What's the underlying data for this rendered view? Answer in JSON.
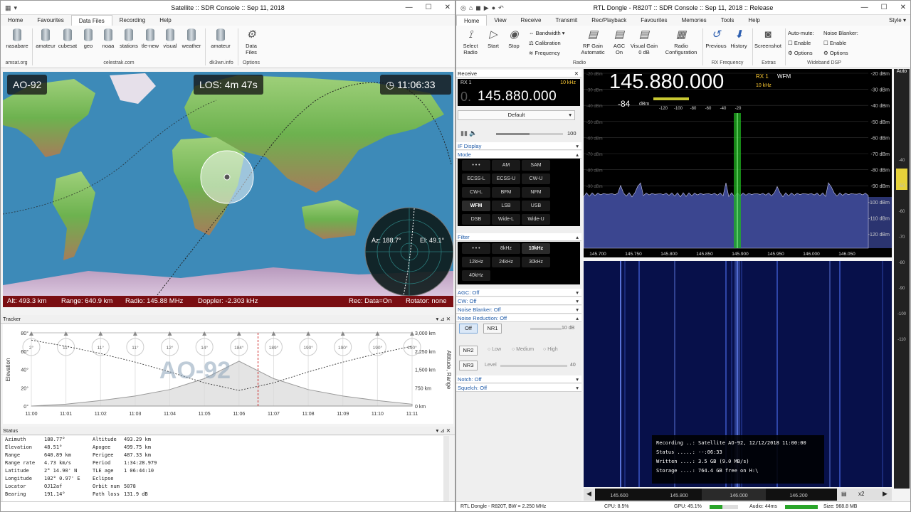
{
  "left": {
    "title": "Satellite :: SDR Console :: Sep 11, 2018",
    "tabs": [
      "Home",
      "Favourites",
      "Data Files",
      "Recording",
      "Help"
    ],
    "active_tab": "Data Files",
    "ribbon_buttons": [
      "nasabare",
      "amateur",
      "cubesat",
      "geo",
      "noaa",
      "stations",
      "tle-new",
      "visual",
      "weather",
      "amateur",
      "Data Files"
    ],
    "group_captions": [
      "amsat.org",
      "celestrak.com",
      "dk3wn.info",
      "Options"
    ],
    "sat_name": "AO-92",
    "los": "LOS: 4m 47s",
    "clock": "11:06:33",
    "az": "Az: 188.7°",
    "el": "El: 49.1°",
    "alt": "Alt: 493.3 km",
    "range": "Range: 640.9 km",
    "radio": "Radio: 145.88 MHz",
    "doppler": "Doppler: -2.303 kHz",
    "rec": "Rec: Data=On",
    "rotator": "Rotator: none",
    "tracker_title": "Tracker",
    "tracker_watermark": "AO-92",
    "tracker_ylabel": "Elevation",
    "tracker_y2label": "Altitude, Range",
    "status_title": "Status",
    "status_left": [
      [
        "Azimuth",
        "188.77°"
      ],
      [
        "Elevation",
        "48.51°"
      ],
      [
        "Range",
        "640.89 km"
      ],
      [
        "Range rate",
        "4.73 km/s"
      ],
      [
        "Latitude",
        "2° 14.90' N"
      ],
      [
        "Longitude",
        "102° 0.97' E"
      ],
      [
        "Locator",
        "OJ12af"
      ],
      [
        "Bearing",
        "191.14°"
      ]
    ],
    "status_right": [
      [
        "Altitude",
        "493.29 km"
      ],
      [
        "Apogee",
        "499.75 km"
      ],
      [
        "Perigee",
        "487.33 km"
      ],
      [
        "Period",
        "1:34:28.979"
      ],
      [
        "TLE age",
        "1 06:44:10"
      ],
      [
        "Eclipse",
        ""
      ],
      [
        "Orbit num",
        "5078"
      ],
      [
        "Path loss",
        "131.9 dB"
      ]
    ]
  },
  "chart_data": {
    "type": "line",
    "x": [
      "11:00",
      "11:01",
      "11:02",
      "11:03",
      "11:04",
      "11:05",
      "11:06",
      "11:07",
      "11:08",
      "11:09",
      "11:10",
      "11:11"
    ],
    "y_ticks_left": [
      "80°",
      "60°",
      "40°",
      "20°",
      "0°"
    ],
    "y_ticks_right": [
      "3,000 km",
      "2,250 km",
      "1,500 km",
      "750 km",
      "0 km"
    ],
    "azimuth_markers": [
      "2°",
      "11°",
      "11°",
      "11°",
      "12°",
      "14°",
      "184°",
      "189°",
      "190°",
      "190°",
      "190°",
      "190°"
    ],
    "ylim": [
      0,
      80
    ],
    "y2lim": [
      0,
      3000
    ],
    "series": [
      {
        "name": "",
        "values": [
          0,
          2,
          6,
          11,
          18,
          30,
          49,
          30,
          18,
          11,
          6,
          2
        ]
      },
      {
        "name": "",
        "values": [
          2700,
          2450,
          2150,
          1800,
          1400,
          950,
          640,
          950,
          1400,
          1800,
          2150,
          2450
        ]
      }
    ]
  },
  "right": {
    "title": "RTL Dongle - R820T :: SDR Console :: Sep 11, 2018 :: Release",
    "style_label": "Style",
    "tabs": [
      "Home",
      "View",
      "Receive",
      "Transmit",
      "Rec/Playback",
      "Favourites",
      "Memories",
      "Tools",
      "Help"
    ],
    "ribbon": {
      "select": "Select Radio",
      "start": "Start",
      "stop": "Stop",
      "bandwidth": "Bandwidth",
      "calibration": "Calibration",
      "frequency": "Frequency",
      "rfgain": "RF Gain Automatic",
      "agc": "AGC On",
      "vgain": "Visual Gain 0 dB",
      "config": "Radio Configuration",
      "previous": "Previous",
      "history": "History",
      "screenshot": "Screenshot",
      "automute": "Auto-mute:",
      "nb": "Noise Blanker:",
      "enable": "Enable",
      "options": "Options",
      "grp_radio": "Radio",
      "grp_rxf": "RX Frequency",
      "grp_extras": "Extras",
      "grp_wdsp": "Wideband DSP"
    },
    "receive": "Receive",
    "rx": "RX 1",
    "step": "10 kHz",
    "frequency": "145.880.000",
    "freq_prefix": "0.",
    "preset": "Default",
    "volume": "100",
    "if_display": "IF Display",
    "mode_title": "Mode",
    "modes": [
      "• • •",
      "AM",
      "SAM",
      "ECSS-L",
      "ECSS-U",
      "CW-U",
      "CW-L",
      "BFM",
      "NFM",
      "WFM",
      "LSB",
      "USB",
      "DSB",
      "Wide-L",
      "Wide-U"
    ],
    "mode_selected": "WFM",
    "filter_title": "Filter",
    "filters": [
      "• • •",
      "8kHz",
      "10kHz",
      "12kHz",
      "24kHz",
      "30kHz",
      "40kHz"
    ],
    "filter_selected": "10kHz",
    "agc": "AGC: Off",
    "cw": "CW: Off",
    "noise_blanker": "Noise Blanker: Off",
    "noise_reduction": "Noise Reduction: Off",
    "nr_off": "Off",
    "nr1": "NR1",
    "nr_db": "10 dB",
    "nr2": "NR2",
    "nr3": "NR3",
    "nr_low": "Low",
    "nr_medium": "Medium",
    "nr_high": "High",
    "level": "Level",
    "level_val": "40",
    "notch": "Notch: Off",
    "squelch": "Squelch: Off",
    "spec_freq": "145.880.000",
    "spec_mode": "WFM",
    "spec_dbm": "-84",
    "dbm_unit": "dBm",
    "meter_ticks": [
      "-120",
      "-100",
      "-80",
      "-60",
      "-40",
      "-20"
    ],
    "db_ticks": [
      "-20 dBm",
      "-30 dBm",
      "-40 dBm",
      "-50 dBm",
      "-60 dBm",
      "-70 dBm",
      "-80 dBm",
      "-90 dBm",
      "-100 dBm",
      "-110 dBm",
      "-120 dBm"
    ],
    "freq_ticks": [
      "145.700",
      "145.750",
      "145.800",
      "145.850",
      "145.900",
      "145.950",
      "146.000",
      "146.050"
    ],
    "wf_ticks": [
      "145.600",
      "145.800",
      "146.000",
      "146.200"
    ],
    "auto": "Auto",
    "scale_ticks": [
      "-40",
      "-50",
      "-60",
      "-70",
      "-80",
      "-90",
      "-100",
      "-110"
    ],
    "rec_lines": [
      "Recording ..: Satellite AO-92,  12/12/2018 11:00:00",
      "Status .....: --:06:33",
      "Written ....: 3.5 GB (9.0 MB/s)",
      "Storage ....: 764.4 GB free on H:\\"
    ],
    "zoom": "x2",
    "status_bar": {
      "device": "RTL Dongle - R820T, BW = 2.250 MHz",
      "cpu": "CPU: 8.5%",
      "gpu": "GPU: 45.1%",
      "audio": "Audio: 44ms",
      "size": "Size: 968.8 MB"
    }
  }
}
